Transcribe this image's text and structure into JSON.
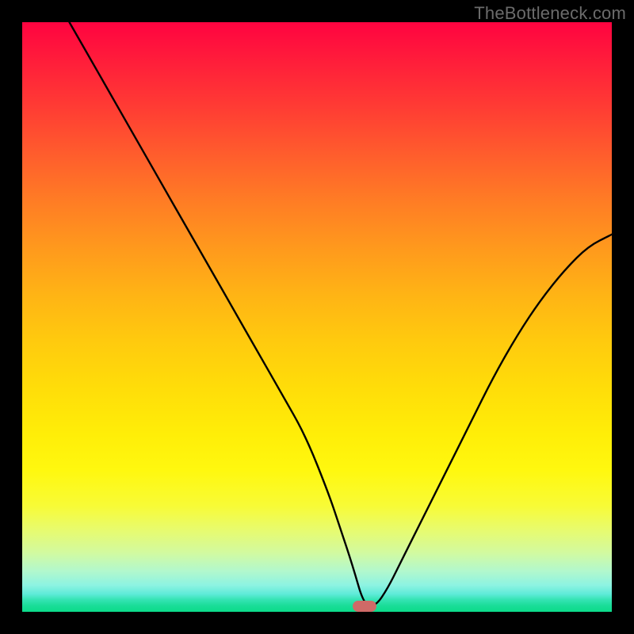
{
  "watermark": "TheBottleneck.com",
  "marker": {
    "color": "#cf6a67",
    "x_pct": 58.0,
    "y_pct": 99.0
  },
  "chart_data": {
    "type": "line",
    "title": "",
    "xlabel": "",
    "ylabel": "",
    "xlim": [
      0,
      100
    ],
    "ylim": [
      0,
      100
    ],
    "grid": false,
    "legend": false,
    "series": [
      {
        "name": "bottleneck-curve",
        "x": [
          8,
          12,
          16,
          20,
          24,
          28,
          32,
          36,
          40,
          44,
          48,
          52,
          54,
          56,
          58,
          60,
          62,
          64,
          68,
          72,
          76,
          80,
          84,
          88,
          92,
          96,
          100
        ],
        "y": [
          100,
          93,
          86,
          79,
          72,
          65,
          58,
          51,
          44,
          37,
          30,
          20,
          14,
          8,
          1,
          1,
          4,
          8,
          16,
          24,
          32,
          40,
          47,
          53,
          58,
          62,
          64
        ]
      }
    ],
    "annotations": [
      {
        "type": "pill-marker",
        "x": 58,
        "y": 1,
        "color": "#cf6a67"
      }
    ],
    "background_gradient": {
      "direction": "vertical",
      "stops": [
        {
          "pos": 0.0,
          "color": "#ff0340"
        },
        {
          "pos": 0.5,
          "color": "#ffca0e"
        },
        {
          "pos": 0.8,
          "color": "#f8fb36"
        },
        {
          "pos": 1.0,
          "color": "#0bdb8a"
        }
      ]
    }
  }
}
